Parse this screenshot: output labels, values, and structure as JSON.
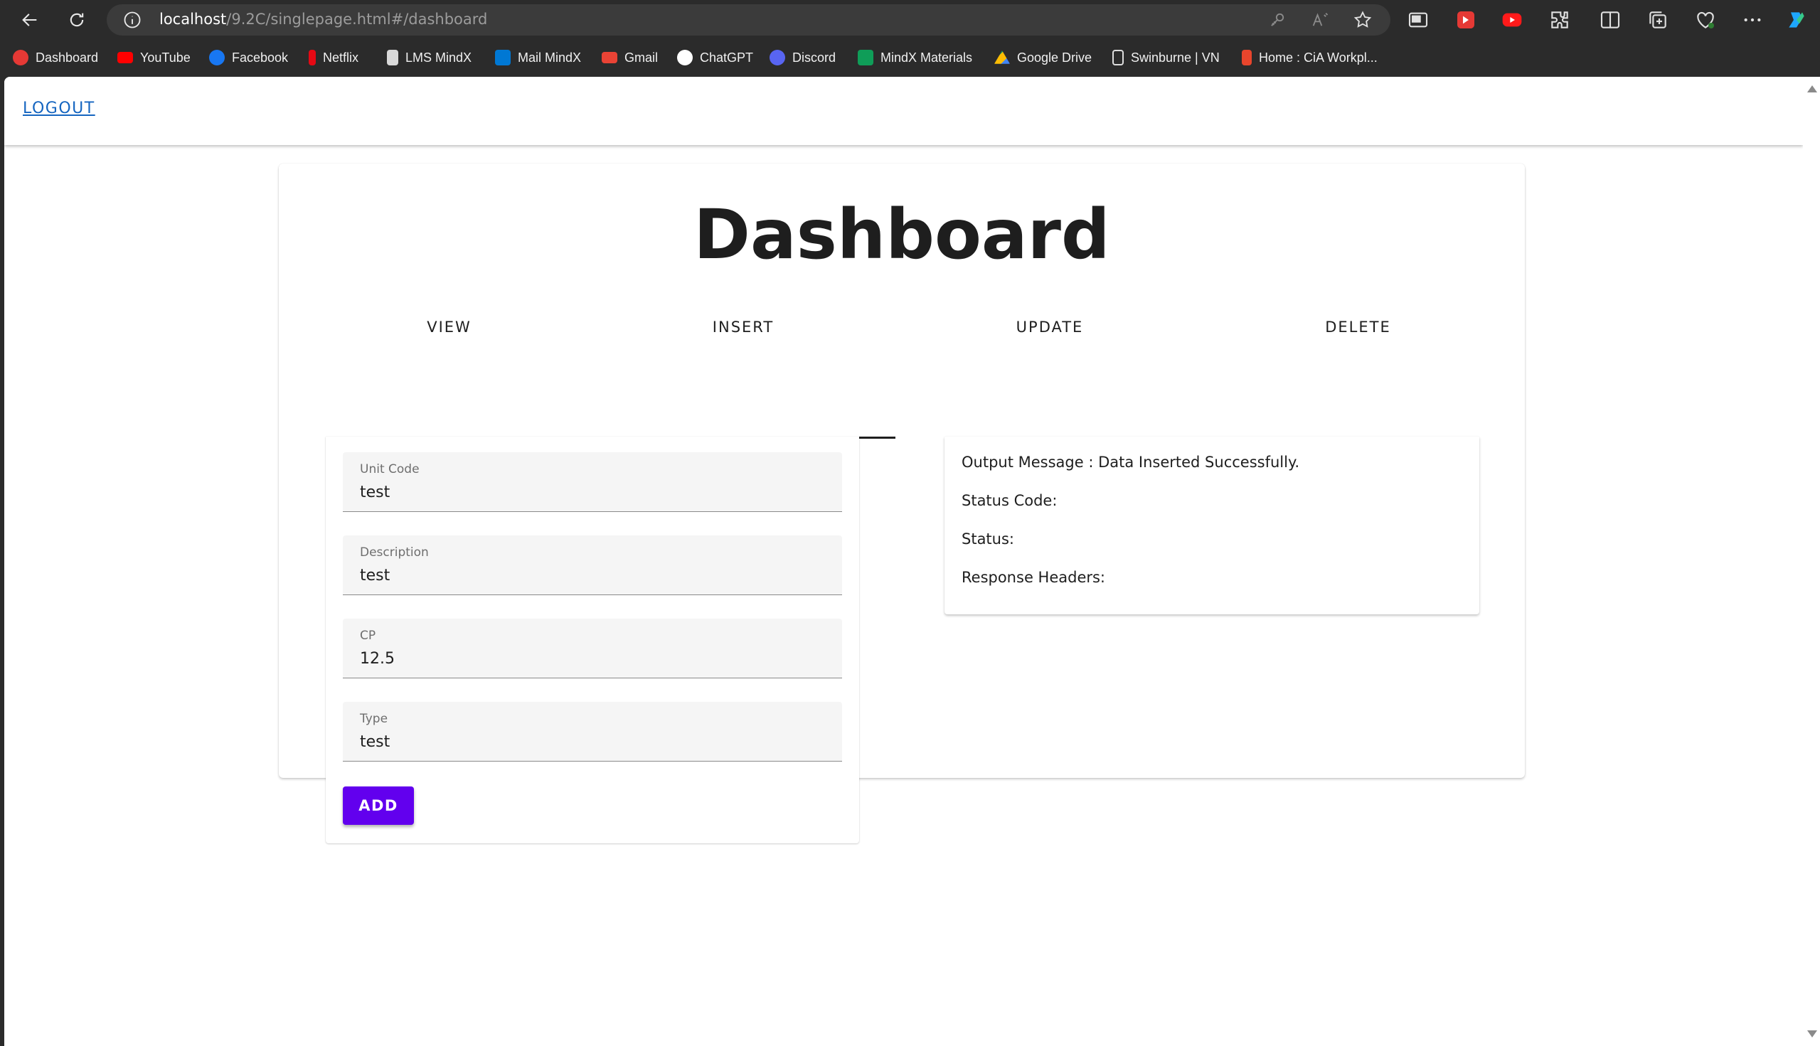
{
  "browser": {
    "url_host": "localhost",
    "url_path": "/9.2C/singlepage.html#/dashboard",
    "bookmarks": [
      {
        "label": "Dashboard",
        "color": "#e53935"
      },
      {
        "label": "YouTube",
        "color": "#ff0000"
      },
      {
        "label": "Facebook",
        "color": "#1877f2"
      },
      {
        "label": "Netflix",
        "color": "#e50914"
      },
      {
        "label": "LMS MindX",
        "color": "#d9d9d9"
      },
      {
        "label": "Mail MindX",
        "color": "#0078d4"
      },
      {
        "label": "Gmail",
        "color": "#ea4335"
      },
      {
        "label": "ChatGPT",
        "color": "#ffffff"
      },
      {
        "label": "Discord",
        "color": "#5865f2"
      },
      {
        "label": "MindX Materials",
        "color": "#0f9d58"
      },
      {
        "label": "Google Drive",
        "color": "#fbbc04"
      },
      {
        "label": "Swinburne | VN",
        "color": "#dddddd"
      },
      {
        "label": "Home : CiA Workpl...",
        "color": "#e8452c"
      }
    ]
  },
  "appbar": {
    "logout_label": "LOGOUT"
  },
  "page": {
    "title": "Dashboard",
    "tabs": [
      {
        "label": "VIEW",
        "active": false
      },
      {
        "label": "INSERT",
        "active": true
      },
      {
        "label": "UPDATE",
        "active": false
      },
      {
        "label": "DELETE",
        "active": false
      }
    ]
  },
  "form": {
    "fields": [
      {
        "label": "Unit Code",
        "value": "test"
      },
      {
        "label": "Description",
        "value": "test"
      },
      {
        "label": "CP",
        "value": "12.5"
      },
      {
        "label": "Type",
        "value": "test"
      }
    ],
    "add_label": "ADD",
    "accent_color": "#6200ee"
  },
  "output": {
    "message": "Output Message : Data Inserted Successfully.",
    "status_code": "Status Code:",
    "status": "Status:",
    "headers": "Response Headers:"
  }
}
